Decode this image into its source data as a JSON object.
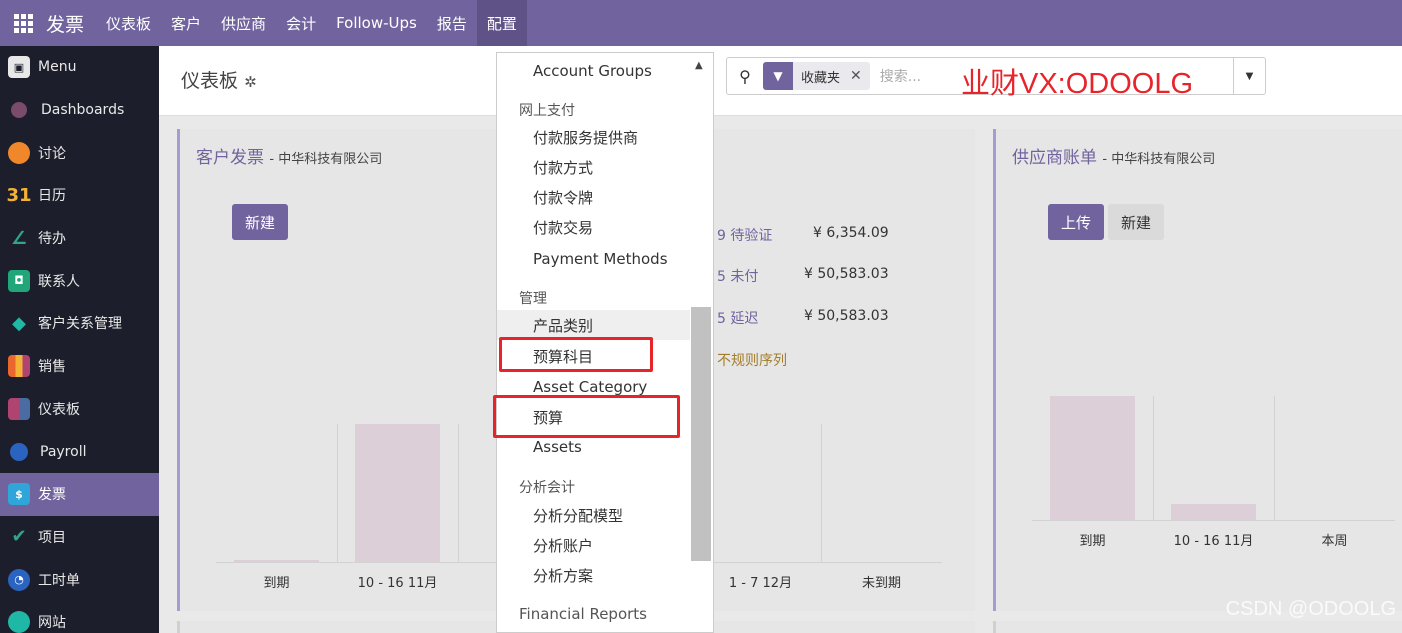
{
  "topbar": {
    "brand": "发票",
    "items": [
      "仪表板",
      "客户",
      "供应商",
      "会计",
      "Follow-Ups",
      "报告",
      "配置"
    ],
    "active": "配置"
  },
  "sidebar": {
    "items": [
      {
        "label": "Menu",
        "icon": "menu-icon",
        "color": "#4b6ca3"
      },
      {
        "label": "Dashboards",
        "icon": "dashboards-icon",
        "color": "#7a4b6a"
      },
      {
        "label": "讨论",
        "icon": "discuss-icon",
        "color": "#f0882b"
      },
      {
        "label": "日历",
        "icon": "calendar-icon",
        "color": "#f3b135"
      },
      {
        "label": "待办",
        "icon": "todo-icon",
        "color": "#2fa58e"
      },
      {
        "label": "联系人",
        "icon": "contacts-icon",
        "color": "#21a67a"
      },
      {
        "label": "客户关系管理",
        "icon": "crm-icon",
        "color": "#1fb7a5"
      },
      {
        "label": "销售",
        "icon": "sales-icon",
        "color": "#e9672f"
      },
      {
        "label": "仪表板",
        "icon": "dashboard-icon",
        "color": "#b04470"
      },
      {
        "label": "Payroll",
        "icon": "payroll-icon",
        "color": "#2a64c0"
      },
      {
        "label": "发票",
        "icon": "invoice-icon",
        "color": "#2fa5d9"
      },
      {
        "label": "项目",
        "icon": "project-icon",
        "color": "#2fa58e"
      },
      {
        "label": "工时单",
        "icon": "timesheet-icon",
        "color": "#2a64c0"
      },
      {
        "label": "网站",
        "icon": "website-icon",
        "color": "#1fb7a5"
      }
    ],
    "active": "发票"
  },
  "control": {
    "breadcrumb": "仪表板",
    "facet": "收藏夹",
    "placeholder": "搜索...",
    "watermark": "业财VX:ODOOLG"
  },
  "customer_card": {
    "title": "客户发票",
    "company": "- 中华科技有限公司",
    "new_button": "新建",
    "stats": [
      {
        "label": "9 待验证",
        "amount": "¥ 6,354.09"
      },
      {
        "label": "5 未付",
        "amount": "¥ 50,583.03"
      },
      {
        "label": "5 延迟",
        "amount": "¥ 50,583.03"
      }
    ],
    "irregular": "不规则序列"
  },
  "supplier_card": {
    "title": "供应商账单",
    "company": "- 中华科技有限公司",
    "upload_button": "上传",
    "new_button": "新建"
  },
  "chart_data": [
    {
      "type": "bar",
      "categories": [
        "到期",
        "10 - 16 11月",
        "",
        "",
        "1 - 7 12月",
        "未到期"
      ],
      "values": [
        1,
        100,
        0,
        0,
        0,
        0
      ],
      "title": "",
      "xlabel": "",
      "ylabel": ""
    },
    {
      "type": "bar",
      "categories": [
        "到期",
        "10 - 16 11月",
        "本周"
      ],
      "values": [
        100,
        13,
        0
      ],
      "title": "",
      "xlabel": "",
      "ylabel": ""
    }
  ],
  "dropdown": {
    "sections": [
      {
        "header": "",
        "items": [
          "Account Groups"
        ]
      },
      {
        "header": "网上支付",
        "items": [
          "付款服务提供商",
          "付款方式",
          "付款令牌",
          "付款交易",
          "Payment Methods"
        ]
      },
      {
        "header": "管理",
        "items": [
          "产品类别",
          "预算科目",
          "Asset Category",
          "预算",
          "Assets"
        ]
      },
      {
        "header": "分析会计",
        "items": [
          "分析分配模型",
          "分析账户",
          "分析方案"
        ]
      },
      {
        "header": "Financial Reports",
        "items": []
      }
    ],
    "hovered": "产品类别",
    "highlighted": [
      "预算科目",
      "预算"
    ]
  },
  "footer_watermark": "CSDN @ODOOLG",
  "colors": {
    "brand": "#71639e",
    "sidebar": "#1c1f2b",
    "highlight": "#e8242b"
  }
}
